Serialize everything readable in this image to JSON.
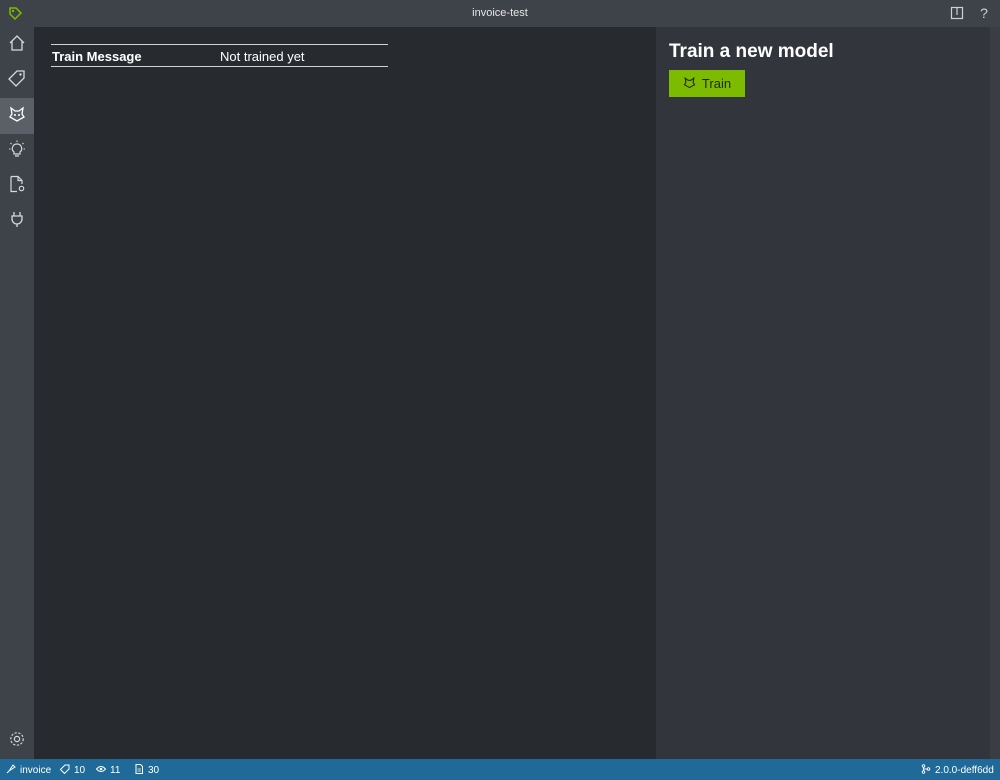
{
  "window": {
    "title": "invoice-test",
    "accent": "#7dbb00",
    "icons": [
      "tag-logo-icon",
      "layout-icon",
      "help-icon"
    ],
    "help_label": "?"
  },
  "sidebar": {
    "items": [
      {
        "name": "home",
        "icon": "home-icon",
        "active": false
      },
      {
        "name": "tags",
        "icon": "tag-icon",
        "active": false
      },
      {
        "name": "train",
        "icon": "train-icon",
        "active": true
      },
      {
        "name": "predict",
        "icon": "lightbulb-icon",
        "active": false
      },
      {
        "name": "settings-doc",
        "icon": "document-settings-icon",
        "active": false
      },
      {
        "name": "connections",
        "icon": "plug-icon",
        "active": false
      }
    ],
    "footer_icon": "gear-icon"
  },
  "main": {
    "table": {
      "rows": [
        {
          "key": "Train Message",
          "value": "Not trained yet"
        }
      ]
    }
  },
  "right_panel": {
    "heading": "Train a new model",
    "train_button": "Train",
    "train_button_icon": "train-icon"
  },
  "statusbar": {
    "project": "invoice",
    "tags_count": "10",
    "visited_count": "11",
    "assets_count": "30",
    "version": "2.0.0-deff6dd"
  }
}
